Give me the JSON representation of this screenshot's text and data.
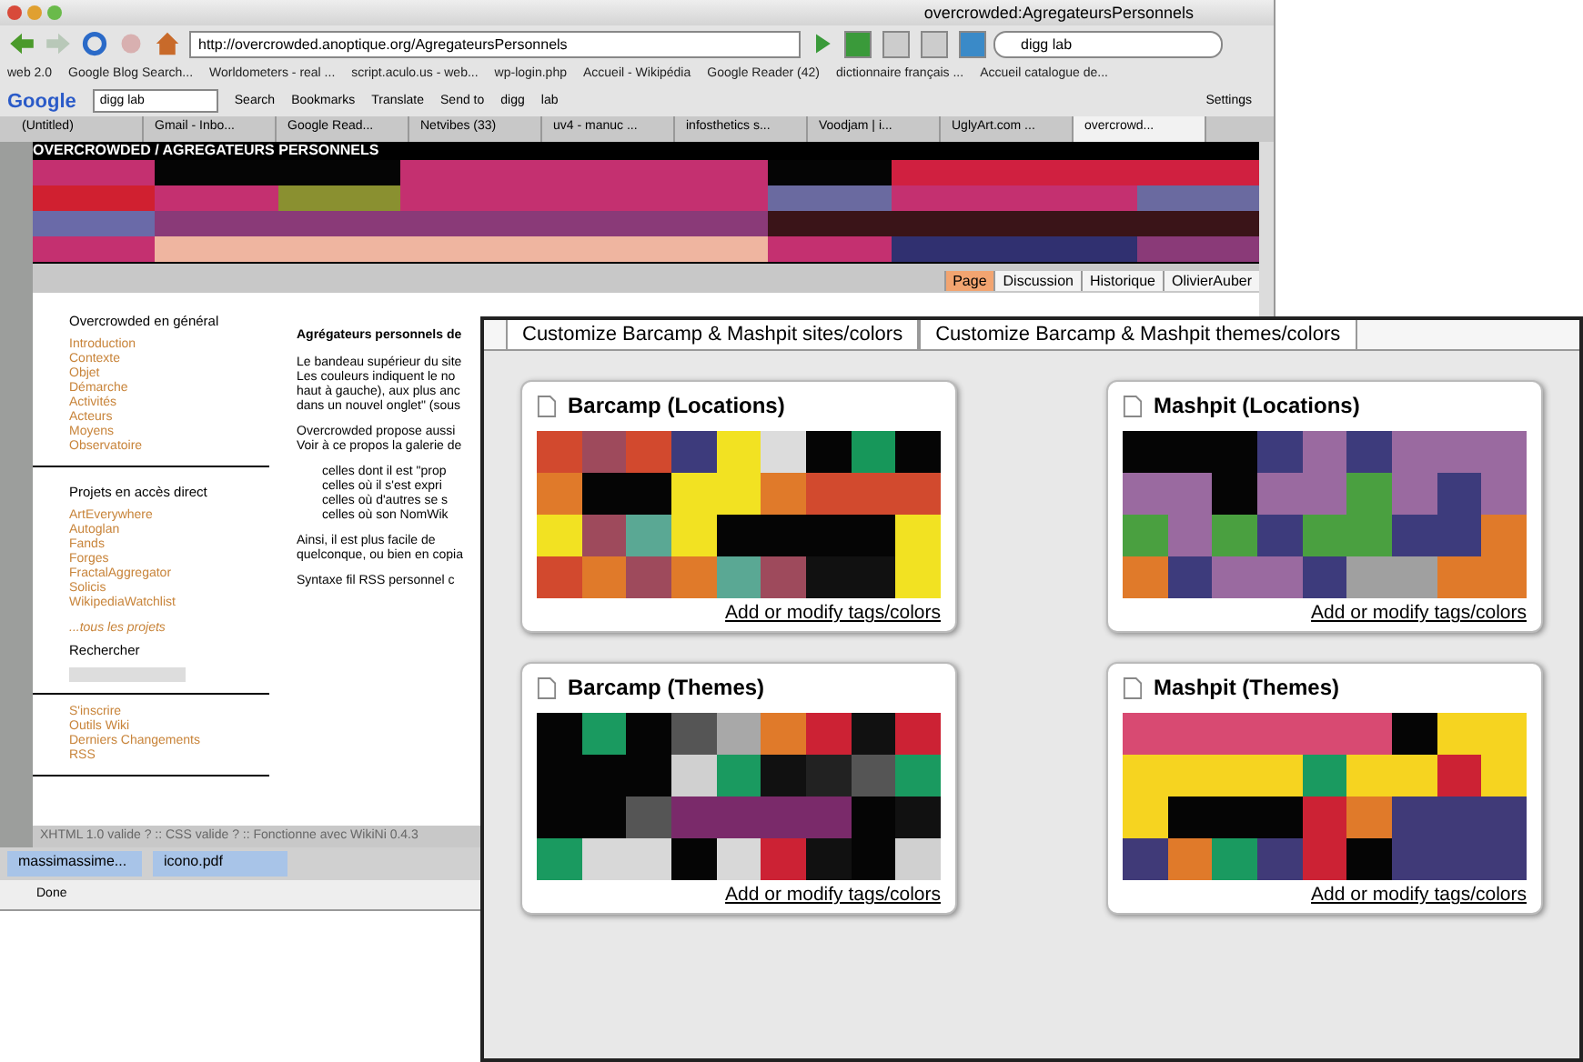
{
  "window": {
    "title": "overcrowded:AgregateursPersonnels"
  },
  "navigation": {
    "url": "http://overcrowded.anoptique.org/AgregateursPersonnels",
    "search": "digg lab"
  },
  "bookmarks": [
    "web 2.0",
    "Google Blog Search...",
    "Worldometers - real ...",
    "script.aculo.us - web...",
    "wp-login.php",
    "Accueil - Wikipédia",
    "Google Reader (42)",
    "dictionnaire français ...",
    "Accueil catalogue de..."
  ],
  "google_toolbar": {
    "logo": "Google",
    "query": "digg lab",
    "items": [
      "Search",
      "Bookmarks",
      "Translate",
      "Send to",
      "digg",
      "lab"
    ],
    "settings": "Settings"
  },
  "tabs": [
    {
      "label": "(Untitled)",
      "selected": false
    },
    {
      "label": "Gmail - Inbo...",
      "selected": false
    },
    {
      "label": "Google Read...",
      "selected": false
    },
    {
      "label": "Netvibes (33)",
      "selected": false
    },
    {
      "label": "uv4 - manuc ...",
      "selected": false
    },
    {
      "label": "infosthetics s...",
      "selected": false
    },
    {
      "label": "Voodjam | i...",
      "selected": false
    },
    {
      "label": "UglyArt.com ...",
      "selected": false
    },
    {
      "label": "overcrowd...",
      "selected": true
    }
  ],
  "site": {
    "header": "OVERCROWDED / AGREGATEURS PERSONNELS",
    "banner": [
      [
        {
          "color": "#c43070"
        },
        {
          "color": "#050505"
        },
        {
          "color": "#050505"
        },
        {
          "color": "#c43070"
        },
        {
          "color": "#c43070"
        },
        {
          "color": "#c43070"
        },
        {
          "color": "#050505"
        },
        {
          "color": "#d02040"
        },
        {
          "color": "#d02040"
        },
        {
          "color": "#d02040"
        }
      ],
      [
        {
          "color": "#d02030"
        },
        {
          "color": "#c43070"
        },
        {
          "color": "#8a9030"
        },
        {
          "color": "#c43070"
        },
        {
          "color": "#c43070"
        },
        {
          "color": "#c43070"
        },
        {
          "color": "#6a6aa0"
        },
        {
          "color": "#c43070"
        },
        {
          "color": "#c43070"
        },
        {
          "color": "#6a6aa0"
        }
      ],
      [
        {
          "color": "#6a6aa8"
        },
        {
          "color": "#8a3a78"
        },
        {
          "color": "#8a3a78"
        },
        {
          "color": "#8a3a78"
        },
        {
          "color": "#8a3a78"
        },
        {
          "color": "#8a3a78"
        },
        {
          "color": "#3a1418"
        },
        {
          "color": "#3a1418"
        },
        {
          "color": "#3a1418"
        },
        {
          "color": "#3a1418"
        }
      ],
      [
        {
          "color": "#c43070"
        },
        {
          "color": "#efb5a0"
        },
        {
          "color": "#efb5a0"
        },
        {
          "color": "#efb5a0"
        },
        {
          "color": "#efb5a0"
        },
        {
          "color": "#efb5a0"
        },
        {
          "color": "#c43070"
        },
        {
          "color": "#303070"
        },
        {
          "color": "#303070"
        },
        {
          "color": "#8a3a78"
        }
      ]
    ],
    "page_tabs": [
      {
        "label": "Page",
        "selected": true
      },
      {
        "label": "Discussion",
        "selected": false
      },
      {
        "label": "Historique",
        "selected": false
      },
      {
        "label": "OlivierAuber",
        "selected": false
      }
    ],
    "sidebar": [
      {
        "heading": "Overcrowded en général",
        "links": [
          "Introduction",
          "Contexte",
          "Objet",
          "Démarche",
          "Activités",
          "Acteurs",
          "Moyens",
          "Observatoire"
        ]
      },
      {
        "heading": "Projets en accès direct",
        "links": [
          "ArtEverywhere",
          "Autoglan",
          "Fands",
          "Forges",
          "FractalAggregator",
          "Solicis",
          "WikipediaWatchlist"
        ],
        "more": "...tous les projets",
        "search_label": "Rechercher"
      },
      {
        "links": [
          "S'inscrire",
          "Outils Wiki",
          "Derniers Changements",
          "RSS"
        ]
      }
    ],
    "title": "Agrégateurs personnels de",
    "paragraphs": [
      [
        "Le bandeau supérieur du site",
        "Les couleurs indiquent le no",
        "haut à gauche), aux plus anc",
        "dans un nouvel onglet\" (sous"
      ],
      [
        "Overcrowded propose aussi",
        "Voir à ce propos la galerie de"
      ]
    ],
    "bullets": [
      "celles dont il est \"prop",
      "celles où il s'est expri",
      "celles où d'autres se s",
      "celles où son NomWik"
    ],
    "after": [
      [
        "Ainsi, il est plus facile de",
        "quelconque, ou bien en copia"
      ],
      [
        "Syntaxe fil RSS personnel c"
      ]
    ],
    "footer": "XHTML 1.0 valide ? :: CSS valide ? :: Fonctionne avec WikiNi 0.4.3"
  },
  "downloads": [
    "massimassime...",
    "icono.pdf"
  ],
  "status_bar": "Done",
  "panel": {
    "tabs": [
      "Customize Barcamp & Mashpit sites/colors",
      "Customize Barcamp & Mashpit themes/colors"
    ],
    "cards": [
      {
        "title": "Barcamp (Locations)",
        "link": "Add or modify tags/colors",
        "cells": [
          [
            {
              "color": "#d2492e"
            },
            {
              "color": "#9e4a5c"
            },
            {
              "color": "#d2492e"
            },
            {
              "color": "#3d3b7c"
            },
            {
              "color": "#f2e222"
            },
            {
              "color": "#dcdcdc"
            },
            {
              "color": "#050505"
            },
            {
              "color": "#17975a"
            },
            {
              "color": "#050505"
            }
          ],
          [
            {
              "color": "#e07a2a"
            },
            {
              "color": "#050505"
            },
            {
              "color": "#050505"
            },
            {
              "color": "#f2e222"
            },
            {
              "color": "#f2e222"
            },
            {
              "color": "#e07a2a"
            },
            {
              "color": "#d24a2e"
            },
            {
              "color": "#d24a2e"
            },
            {
              "color": "#d24a2e"
            }
          ],
          [
            {
              "color": "#f2e222"
            },
            {
              "color": "#9e4a5c"
            },
            {
              "color": "#5aa894"
            },
            {
              "color": "#f2e222"
            },
            {
              "color": "#050505"
            },
            {
              "color": "#050505"
            },
            {
              "color": "#050505"
            },
            {
              "color": "#050505"
            },
            {
              "color": "#f2e222"
            }
          ],
          [
            {
              "color": "#d2492e"
            },
            {
              "color": "#e07a2a"
            },
            {
              "color": "#9e4a5c"
            },
            {
              "color": "#e07a2a"
            },
            {
              "color": "#5aa894"
            },
            {
              "color": "#9e4a5c"
            },
            {
              "color": "#111111"
            },
            {
              "color": "#111111"
            },
            {
              "color": "#f2e222"
            }
          ]
        ]
      },
      {
        "title": "Mashpit (Locations)",
        "link": "Add or modify tags/colors",
        "cells": [
          [
            {
              "color": "#050505"
            },
            {
              "color": "#050505"
            },
            {
              "color": "#050505"
            },
            {
              "color": "#3d3b7c"
            },
            {
              "color": "#9a6aa0"
            },
            {
              "color": "#3d3b7c"
            },
            {
              "color": "#9a6aa0"
            },
            {
              "color": "#9a6aa0"
            },
            {
              "color": "#9a6aa0"
            }
          ],
          [
            {
              "color": "#9a6aa0"
            },
            {
              "color": "#9a6aa0"
            },
            {
              "color": "#050505"
            },
            {
              "color": "#9a6aa0"
            },
            {
              "color": "#9a6aa0"
            },
            {
              "color": "#4aa040"
            },
            {
              "color": "#9a6aa0"
            },
            {
              "color": "#3d3b7c"
            },
            {
              "color": "#9a6aa0"
            }
          ],
          [
            {
              "color": "#4aa040"
            },
            {
              "color": "#9a6aa0"
            },
            {
              "color": "#4aa040"
            },
            {
              "color": "#3d3b7c"
            },
            {
              "color": "#4aa040"
            },
            {
              "color": "#4aa040"
            },
            {
              "color": "#3d3b7c"
            },
            {
              "color": "#3d3b7c"
            },
            {
              "color": "#e07a2a"
            }
          ],
          [
            {
              "color": "#e07a2a"
            },
            {
              "color": "#3d3b7c"
            },
            {
              "color": "#9a6aa0"
            },
            {
              "color": "#9a6aa0"
            },
            {
              "color": "#3d3b7c"
            },
            {
              "color": "#a0a0a0"
            },
            {
              "color": "#a0a0a0"
            },
            {
              "color": "#e07a2a"
            },
            {
              "color": "#e07a2a"
            }
          ]
        ]
      },
      {
        "title": "Barcamp (Themes)",
        "link": "Add or modify tags/colors",
        "cells": [
          [
            {
              "color": "#050505"
            },
            {
              "color": "#1a9a60"
            },
            {
              "color": "#050505"
            },
            {
              "color": "#555555"
            },
            {
              "color": "#a8a8a8"
            },
            {
              "color": "#e07a2a"
            },
            {
              "color": "#cc2234"
            },
            {
              "color": "#111111"
            },
            {
              "color": "#cc2234"
            }
          ],
          [
            {
              "color": "#050505"
            },
            {
              "color": "#050505"
            },
            {
              "color": "#050505"
            },
            {
              "color": "#d0d0d0"
            },
            {
              "color": "#1a9a60"
            },
            {
              "color": "#111111"
            },
            {
              "color": "#222222"
            },
            {
              "color": "#555555"
            },
            {
              "color": "#1a9a60"
            }
          ],
          [
            {
              "color": "#050505"
            },
            {
              "color": "#050505"
            },
            {
              "color": "#555555"
            },
            {
              "color": "#7a2a6a"
            },
            {
              "color": "#7a2a6a"
            },
            {
              "color": "#7a2a6a"
            },
            {
              "color": "#7a2a6a"
            },
            {
              "color": "#050505"
            },
            {
              "color": "#111111"
            }
          ],
          [
            {
              "color": "#1a9a60"
            },
            {
              "color": "#d8d8d8"
            },
            {
              "color": "#d8d8d8"
            },
            {
              "color": "#050505"
            },
            {
              "color": "#d8d8d8"
            },
            {
              "color": "#cc2234"
            },
            {
              "color": "#111111"
            },
            {
              "color": "#050505"
            },
            {
              "color": "#d0d0d0"
            }
          ]
        ]
      },
      {
        "title": "Mashpit (Themes)",
        "link": "Add or modify tags/colors",
        "cells": [
          [
            {
              "color": "#d84a72"
            },
            {
              "color": "#d84a72"
            },
            {
              "color": "#d84a72"
            },
            {
              "color": "#d84a72"
            },
            {
              "color": "#d84a72"
            },
            {
              "color": "#d84a72"
            },
            {
              "color": "#050505"
            },
            {
              "color": "#f6d420"
            },
            {
              "color": "#f6d420"
            }
          ],
          [
            {
              "color": "#f6d420"
            },
            {
              "color": "#f6d420"
            },
            {
              "color": "#f6d420"
            },
            {
              "color": "#f6d420"
            },
            {
              "color": "#1a9a60"
            },
            {
              "color": "#f6d420"
            },
            {
              "color": "#f6d420"
            },
            {
              "color": "#cc2234"
            },
            {
              "color": "#f6d420"
            }
          ],
          [
            {
              "color": "#f6d420"
            },
            {
              "color": "#050505"
            },
            {
              "color": "#050505"
            },
            {
              "color": "#050505"
            },
            {
              "color": "#cc2234"
            },
            {
              "color": "#e07a2a"
            },
            {
              "color": "#403a78"
            },
            {
              "color": "#403a78"
            },
            {
              "color": "#403a78"
            }
          ],
          [
            {
              "color": "#403a78"
            },
            {
              "color": "#e07a2a"
            },
            {
              "color": "#1a9a60"
            },
            {
              "color": "#403a78"
            },
            {
              "color": "#cc2234"
            },
            {
              "color": "#050505"
            },
            {
              "color": "#403a78"
            },
            {
              "color": "#403a78"
            },
            {
              "color": "#403a78"
            }
          ]
        ]
      }
    ]
  }
}
